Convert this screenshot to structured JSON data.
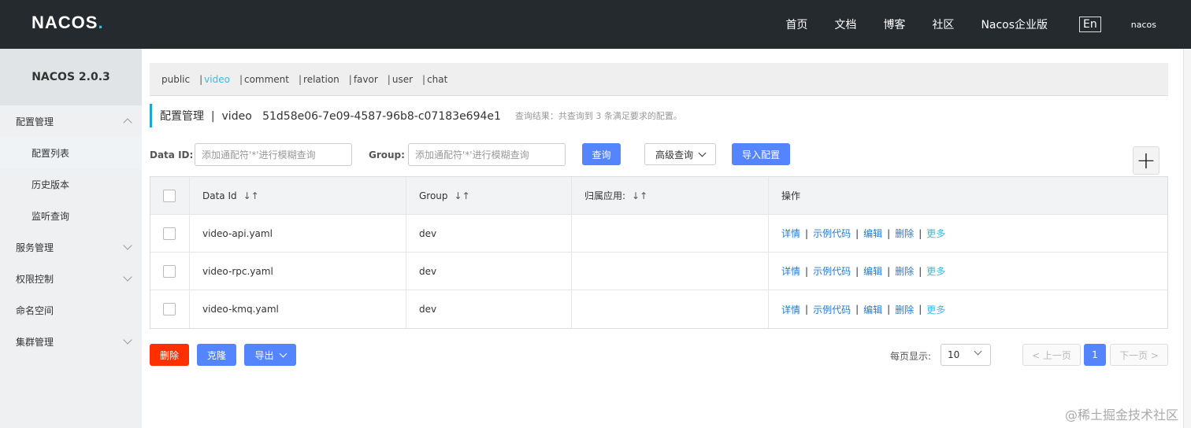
{
  "topbar": {
    "logo_text": "NACOS",
    "logo_dot": ".",
    "nav": [
      "首页",
      "文档",
      "博客",
      "社区",
      "Nacos企业版"
    ],
    "lang": "En",
    "user": "nacos"
  },
  "sidebar": {
    "brand": "NACOS 2.0.3",
    "items": [
      {
        "label": "配置管理"
      },
      {
        "label": "配置列表"
      },
      {
        "label": "历史版本"
      },
      {
        "label": "监听查询"
      },
      {
        "label": "服务管理"
      },
      {
        "label": "权限控制"
      },
      {
        "label": "命名空间"
      },
      {
        "label": "集群管理"
      }
    ]
  },
  "namespaces": [
    "public",
    "video",
    "comment",
    "relation",
    "favor",
    "user",
    "chat"
  ],
  "namespace_sep": "|",
  "page": {
    "title": "配置管理  |  video   51d58e06-7e09-4587-96b8-c07183e694e1",
    "result_hint": "查询结果：共查询到 3 条满足要求的配置。"
  },
  "search": {
    "dataid_label": "Data ID:",
    "dataid_placeholder": "添加通配符'*'进行模糊查询",
    "group_label": "Group:",
    "group_placeholder": "添加通配符'*'进行模糊查询",
    "query_button": "查询",
    "advanced_button": "高级查询",
    "import_button": "导入配置",
    "add_button": "+"
  },
  "table": {
    "headers": [
      "Data Id",
      "Group",
      "归属应用:",
      "操作"
    ],
    "sort_glyph": "↓↑",
    "rows": [
      {
        "data_id": "video-api.yaml",
        "group": "dev",
        "app": ""
      },
      {
        "data_id": "video-rpc.yaml",
        "group": "dev",
        "app": ""
      },
      {
        "data_id": "video-kmq.yaml",
        "group": "dev",
        "app": ""
      }
    ],
    "ops": [
      "详情",
      "示例代码",
      "编辑",
      "删除",
      "更多"
    ],
    "op_sep": "|"
  },
  "bottom": {
    "delete_button": "删除",
    "clone_button": "克隆",
    "export_button": "导出",
    "page_size_label": "每页显示:",
    "page_size": "10",
    "prev": "< 上一页",
    "page": "1",
    "next": "下一页 >"
  },
  "watermark": "@稀土掘金技术社区"
}
